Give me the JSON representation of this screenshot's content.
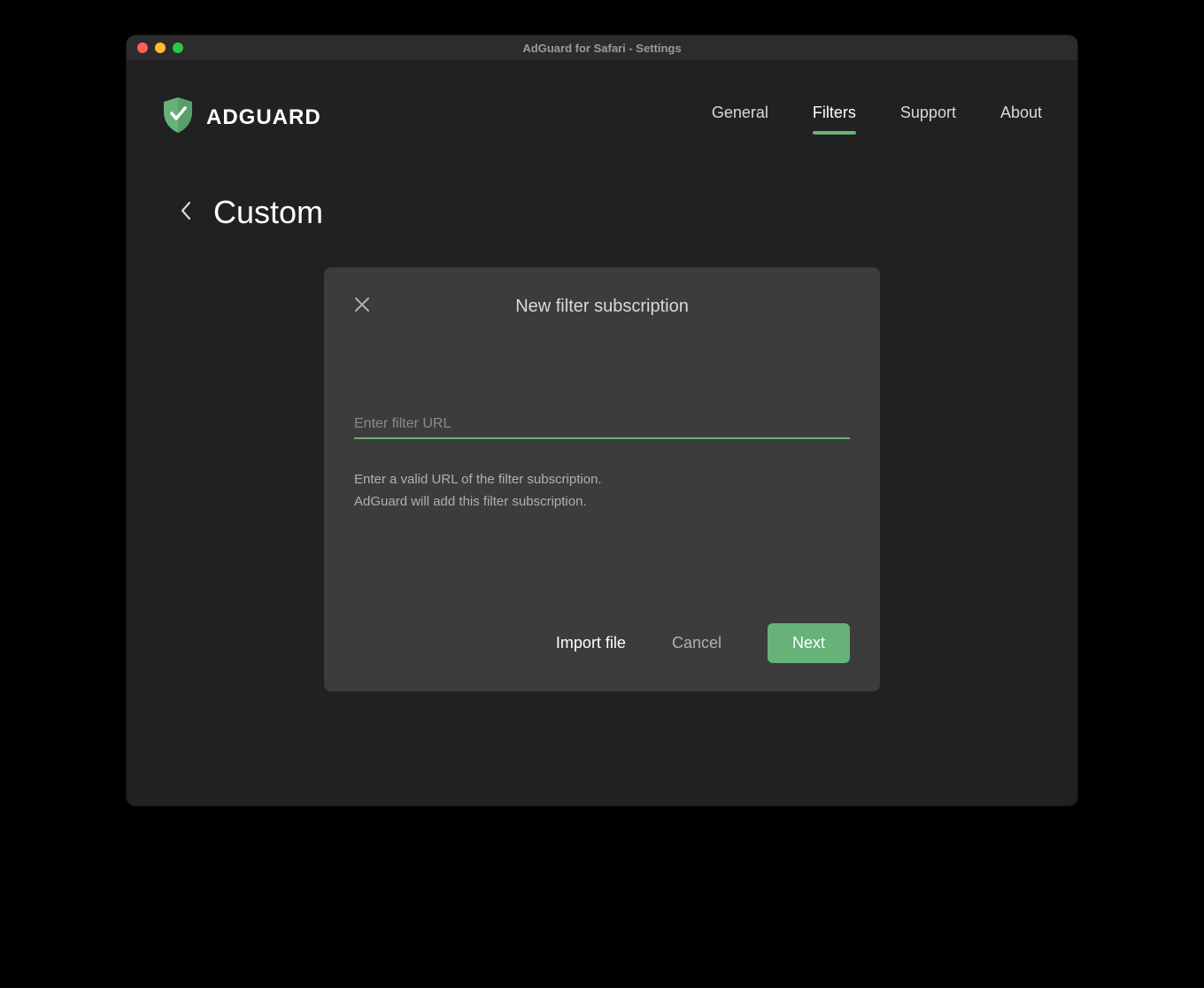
{
  "window_title": "AdGuard for Safari - Settings",
  "brand_name": "ADGUARD",
  "nav": {
    "general": "General",
    "filters": "Filters",
    "support": "Support",
    "about": "About"
  },
  "page": {
    "title": "Custom"
  },
  "modal": {
    "title": "New filter subscription",
    "input_placeholder": "Enter filter URL",
    "helper_line1": "Enter a valid URL of the filter subscription.",
    "helper_line2": "AdGuard will add this filter subscription.",
    "import_label": "Import file",
    "cancel_label": "Cancel",
    "next_label": "Next"
  },
  "colors": {
    "accent": "#67b279",
    "background": "#212121",
    "modal_bg": "#3c3c3c"
  }
}
